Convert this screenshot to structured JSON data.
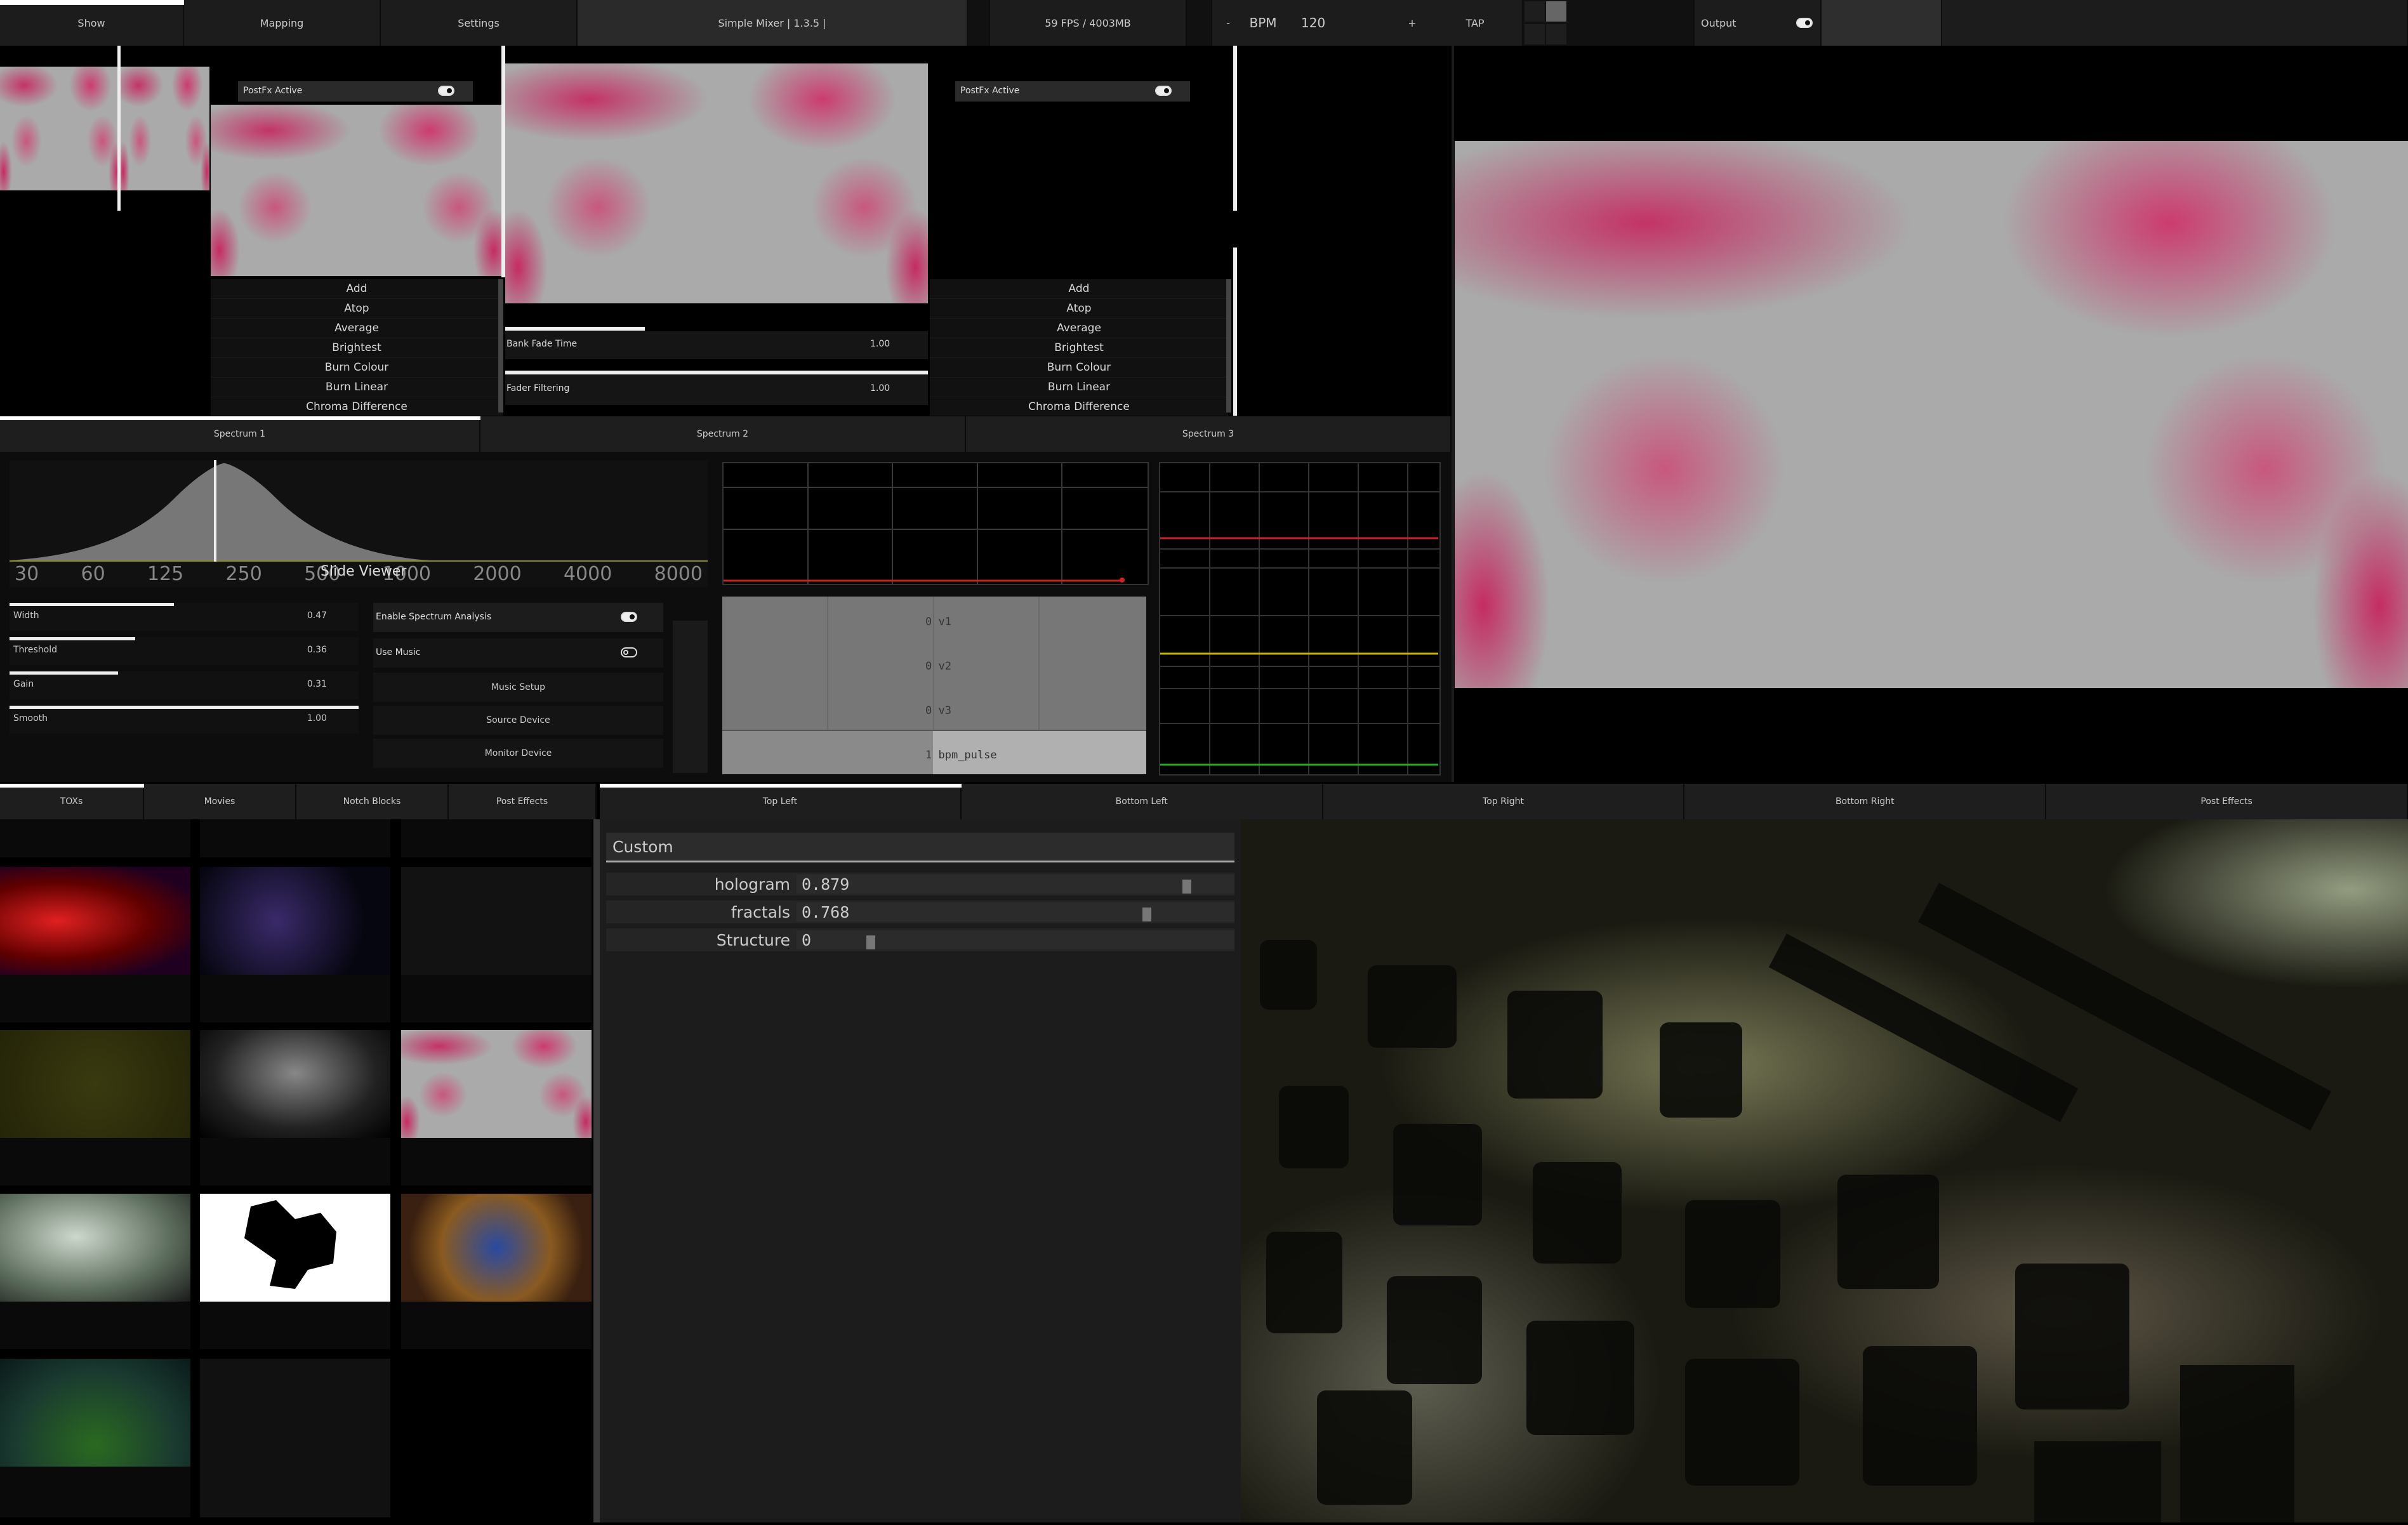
{
  "topbar": {
    "show": "Show",
    "mapping": "Mapping",
    "settings": "Settings",
    "mixer": "Simple Mixer | 1.3.5 |",
    "fps": "59 FPS / 4003MB",
    "minus": "-",
    "bpm_label": "BPM",
    "bpm_value": "120",
    "plus": "+",
    "tap": "TAP",
    "output": "Output"
  },
  "deck_a": {
    "postfx": "PostFx Active",
    "blend_modes": [
      "Add",
      "Atop",
      "Average",
      "Brightest",
      "Burn Colour",
      "Burn Linear",
      "Chroma Difference"
    ]
  },
  "mixer": {
    "bank_fade_label": "Bank Fade Time",
    "bank_fade_value": "1.00",
    "fader_filtering_label": "Fader Filtering",
    "fader_filtering_value": "1.00"
  },
  "deck_b": {
    "postfx": "PostFx Active",
    "blend_modes": [
      "Add",
      "Atop",
      "Average",
      "Brightest",
      "Burn Colour",
      "Burn Linear",
      "Chroma Difference"
    ]
  },
  "spectrum_tabs": [
    "Spectrum 1",
    "Spectrum 2",
    "Spectrum 3"
  ],
  "spectrum": {
    "freq_labels": [
      "30",
      "60",
      "125",
      "250",
      "500",
      "1000",
      "2000",
      "4000",
      "8000"
    ],
    "slide_viewer": "Slide Viewer",
    "params": [
      {
        "label": "Width",
        "value": "0.47"
      },
      {
        "label": "Threshold",
        "value": "0.36"
      },
      {
        "label": "Gain",
        "value": "0.31"
      },
      {
        "label": "Smooth",
        "value": "1.00"
      }
    ],
    "enable_analysis": "Enable Spectrum Analysis",
    "use_music": "Use Music",
    "music_setup": "Music Setup",
    "source_device": "Source Device",
    "monitor_device": "Monitor Device",
    "channels": [
      "0 v1",
      "0 v2",
      "0 v3",
      "1 bpm_pulse"
    ]
  },
  "library_tabs": [
    "TOXs",
    "Movies",
    "Notch Blocks",
    "Post Effects"
  ],
  "layer_tabs": [
    "Top Left",
    "Bottom Left",
    "Top Right",
    "Bottom Right",
    "Post Effects"
  ],
  "custom": {
    "title": "Custom",
    "params": [
      {
        "label": "hologram",
        "value": "0.879",
        "level": 0.879
      },
      {
        "label": "fractals",
        "value": "0.768",
        "level": 0.768
      },
      {
        "label": "Structure",
        "value": "0",
        "level": 0.0
      }
    ]
  },
  "colors": {
    "accent_pink": "#c8285a",
    "trace_red": "#cc2222",
    "trace_yellow": "#c8b400",
    "trace_green": "#22aa22"
  }
}
